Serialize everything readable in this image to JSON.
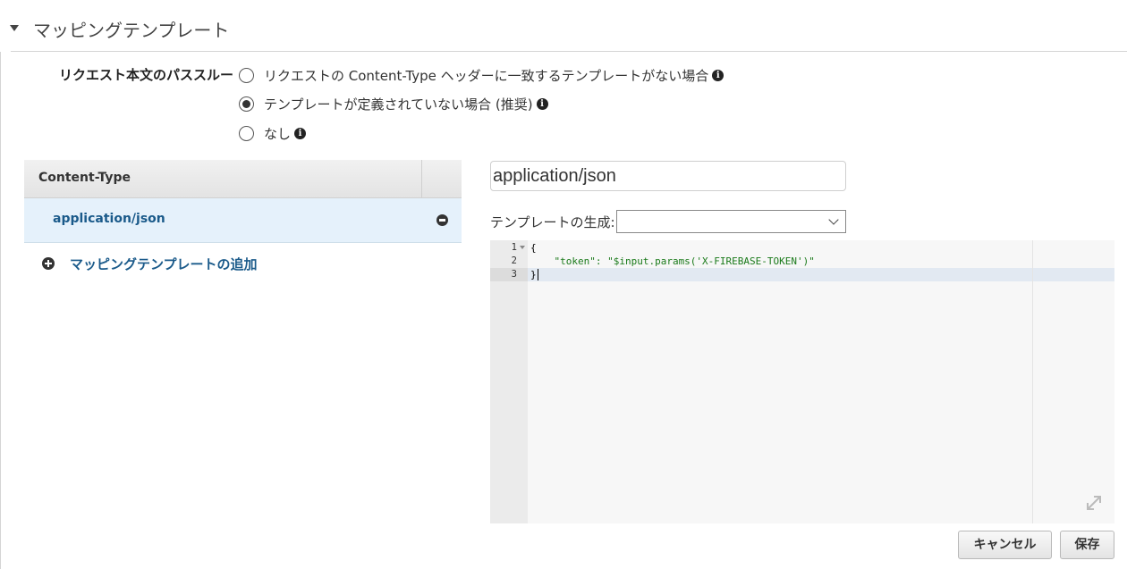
{
  "section": {
    "title": "マッピングテンプレート"
  },
  "passthrough": {
    "label": "リクエスト本文のパススルー",
    "options": [
      {
        "label": "リクエストの Content-Type ヘッダーに一致するテンプレートがない場合",
        "selected": false
      },
      {
        "label": "テンプレートが定義されていない場合 (推奨)",
        "selected": true
      },
      {
        "label": "なし",
        "selected": false
      }
    ],
    "info_icon": "i"
  },
  "content_types": {
    "header": "Content-Type",
    "rows": [
      {
        "name": "application/json"
      }
    ],
    "add_label": "マッピングテンプレートの追加"
  },
  "editor": {
    "content_type_value": "application/json",
    "generate_label": "テンプレートの生成:",
    "generate_selected": "",
    "line_numbers": [
      "1",
      "2",
      "3"
    ],
    "lines": [
      "{",
      "    \"token\": \"$input.params('X-FIREBASE-TOKEN')\"",
      "}"
    ]
  },
  "buttons": {
    "cancel": "キャンセル",
    "save": "保存"
  }
}
